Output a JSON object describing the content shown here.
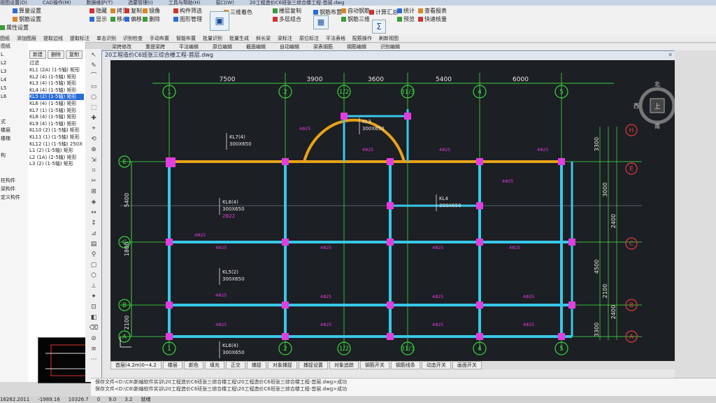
{
  "titlebar": {
    "menus": [
      "视图设置(D)",
      "CAD操作(M)",
      "数据维护(T)",
      "选要管理(I)",
      "工具与帮助(H)",
      "窗口(W)"
    ],
    "file_title": "20工程造价C6班张三综合楼工程-首层.dwg"
  },
  "ribbon": {
    "groups": [
      {
        "label": "算量设置"
      },
      {
        "label": "钢筋设置"
      },
      {
        "label": "属性设置"
      },
      {
        "label": "隐藏"
      },
      {
        "label": "显示"
      },
      {
        "label": "拷贝"
      },
      {
        "label": "移动"
      },
      {
        "label": "复制"
      },
      {
        "label": "偏移"
      },
      {
        "label": "镜像"
      },
      {
        "label": "删除"
      },
      {
        "label": "构件筛选"
      },
      {
        "label": "图形管理"
      },
      {
        "label": "三维着色"
      },
      {
        "label": "楼层复制"
      },
      {
        "label": "多层组合"
      },
      {
        "label": "钢筋布置"
      },
      {
        "label": "自动钢筋"
      },
      {
        "label": "钢筋三维"
      },
      {
        "label": "计算汇总"
      },
      {
        "label": "统计"
      },
      {
        "label": "查看报表"
      },
      {
        "label": "预览"
      },
      {
        "label": "快速核量"
      }
    ]
  },
  "toolbar2": [
    "图纸",
    "添加图层",
    "提取边线",
    "提取标注",
    "单击识别",
    "识别检查",
    "手动布置",
    "智能布置",
    "批量识别",
    "批量生成",
    "斜长梁",
    "梁标注",
    "原位标注",
    "平法表格",
    "配筋操作",
    "刷新视图"
  ],
  "toolbar3": [
    "梁跨修改",
    "重提梁跨",
    "平法编辑",
    "原位编辑",
    "截面编辑",
    "自动编辑",
    "梁表钢筋",
    "钢筋编辑",
    "识别编辑"
  ],
  "left_labels": [
    "图纸",
    "L",
    "L2",
    "L3",
    "L4",
    "L5",
    "L6",
    "",
    "",
    "式",
    "楼层",
    "楼梯",
    "",
    "构",
    "",
    "",
    "柱构件",
    "梁构件",
    "定义构件"
  ],
  "list_panel": {
    "buttons": [
      "新建",
      "删除",
      "复制"
    ],
    "filter_label": "过滤",
    "items": [
      {
        "name": "KL1 (2A) (1-5轴)",
        "type": "矩形"
      },
      {
        "name": "KL2 (4) (1-5轴)",
        "type": "矩形"
      },
      {
        "name": "KL3 (4) (1-5轴)",
        "type": "矩形"
      },
      {
        "name": "KL4 (4) (1-5轴)",
        "type": "矩形"
      },
      {
        "name": "KL5 (2) (1-5轴)",
        "type": "矩形",
        "selected": true
      },
      {
        "name": "KL6 (4) (1-5轴)",
        "type": "矩形"
      },
      {
        "name": "KL7 (1) (1-5轴)",
        "type": "矩形"
      },
      {
        "name": "KL8 (4) (1-5轴)",
        "type": "矩形"
      },
      {
        "name": "KL9 (4) (1-5轴)",
        "type": "矩形"
      },
      {
        "name": "KL10 (2) (1-5轴)",
        "type": "矩形"
      },
      {
        "name": "KL11 (1) (1-5轴)",
        "type": "矩形"
      },
      {
        "name": "KL12 (1) (1-5轴)",
        "type": "250X"
      },
      {
        "name": "L1 (2) (1-5轴)",
        "type": "矩形"
      },
      {
        "name": "L2 (1A) (2-5轴)",
        "type": "矩形"
      },
      {
        "name": "L3 (2) (1-5轴)",
        "type": "矩形"
      }
    ]
  },
  "drawing": {
    "window_title": "20工程造价C6班张三综合楼工程-首层.dwg",
    "top_dims": [
      "7500",
      "3900",
      "3600",
      "5400",
      "6000"
    ],
    "axis_top": [
      "1",
      "2",
      "1/2",
      "31/3",
      "4",
      "5"
    ],
    "axis_bottom": [
      "1",
      "2",
      "1/2",
      "31/3",
      "4",
      "5"
    ],
    "axis_left": [
      "E",
      "C",
      "B",
      "A"
    ],
    "axis_right": [
      "H",
      "E",
      "C",
      "B",
      "A"
    ],
    "left_dims": [
      "5400",
      "1800",
      "2100"
    ],
    "right_dims": [
      "3300",
      "3000",
      "2400",
      "4500",
      "2100",
      "2400",
      "3300"
    ],
    "beam_labels": [
      {
        "id": "kl7",
        "name": "KL7(4)",
        "size": "300X650"
      },
      {
        "id": "kl8",
        "name": "KL8(4)",
        "size": "300X650",
        "rebar": "2B22"
      },
      {
        "id": "kl5",
        "name": "KL5(2)",
        "size": "300X650"
      },
      {
        "id": "kl6",
        "name": "KL6(4)",
        "size": "300X650"
      },
      {
        "id": "kl3",
        "name": "KL3",
        "size": "300X650"
      },
      {
        "id": "kl4",
        "name": "KL4",
        "size": "300X650"
      }
    ],
    "compass": {
      "north": "北",
      "south": "南",
      "west": "西",
      "east": "东",
      "center": "上"
    },
    "status_tabs": [
      "首层(4.2m)0~4.2",
      "楼层",
      "颜色",
      "填充",
      "正交",
      "捕捉",
      "对象捕捉",
      "捕捉设置",
      "对象追踪",
      "钢筋开关",
      "钢筋线条",
      "动态开关",
      "画面开关"
    ]
  },
  "command_lines": [
    "保存文件<D:\\C6\\新编软件实训\\20工程造价C6班张三综合楼工程\\20工程造价C6班张三综合楼工程-首层.dwg>成功",
    "保存文件<D:\\C6\\新编软件实训\\20工程造价C6班张三综合楼工程\\20工程造价C6班张三综合楼工程-首层.dwg>成功"
  ],
  "bottom_status": [
    "16262.2011",
    "-1989.16",
    "10326.7",
    "0",
    "9.0",
    "3.2",
    "就绪"
  ],
  "colors": {
    "canvas_bg": "#1c1f24",
    "beam_cyan": "#39c7e8",
    "column_magenta": "#e23de0",
    "axis_green": "#3bd63b",
    "beam_orange": "#e8a21a",
    "text_white": "#e9e9e9",
    "axis_circle_red": "#e33a3a"
  }
}
